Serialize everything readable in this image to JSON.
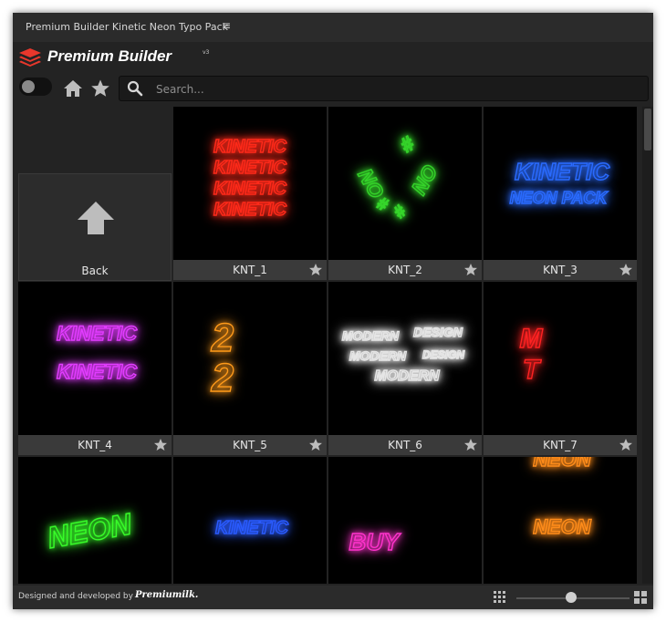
{
  "window": {
    "title": "Premium Builder Kinetic Neon Typo Pack",
    "menu_icon": "hamburger-icon"
  },
  "brand": {
    "name": "Premium Builder",
    "version": "v3",
    "logo_icon": "layers-icon",
    "logo_color": "#e8372c"
  },
  "toolbar": {
    "home_icon": "home-icon",
    "favorites_icon": "star-icon"
  },
  "search": {
    "placeholder": "Search...",
    "value": ""
  },
  "grid": {
    "back": {
      "label": "Back",
      "icon": "arrow-up-icon"
    },
    "items": [
      {
        "label": "KNT_1",
        "preview_text": [
          "KINETIC",
          "KINETIC",
          "KINETIC",
          "KINETIC"
        ],
        "color": "#ff2a1a"
      },
      {
        "label": "KNT_2",
        "preview_text": [
          "NO",
          "#",
          "#",
          "#",
          "NO"
        ],
        "color": "#35d62a"
      },
      {
        "label": "KNT_3",
        "preview_text": [
          "KINETIC",
          "NEON PACK"
        ],
        "color": "#2a6bff"
      },
      {
        "label": "KNT_4",
        "preview_text": [
          "KINETIC",
          "KINETIC"
        ],
        "color": "#e23cff"
      },
      {
        "label": "KNT_5",
        "preview_text": [
          "2",
          "2"
        ],
        "color": "#ff9a1a"
      },
      {
        "label": "KNT_6",
        "preview_text": [
          "MODERN",
          "DESIGN",
          "MODERN",
          "DESIGN",
          "MODERN"
        ],
        "color": "#e6e6e6"
      },
      {
        "label": "KNT_7",
        "preview_text": [
          "M",
          "T"
        ],
        "color": "#ff2222"
      },
      {
        "label": "",
        "preview_text": [
          "NEON"
        ],
        "color": "#39ff2a"
      },
      {
        "label": "",
        "preview_text": [
          "KINETIC"
        ],
        "color": "#2a5bff"
      },
      {
        "label": "",
        "preview_text": [
          "BUY"
        ],
        "color": "#ff33cc"
      },
      {
        "label": "",
        "preview_text": [
          "NEON",
          "NEON"
        ],
        "color": "#ff8c1a"
      }
    ],
    "favorite_icon": "star-icon"
  },
  "footer": {
    "credit": "Designed and developed by",
    "credit_brand": "Premiumilk.",
    "small_grid_icon": "small-grid-icon",
    "large_grid_icon": "large-grid-icon",
    "zoom_level": 0.45
  }
}
